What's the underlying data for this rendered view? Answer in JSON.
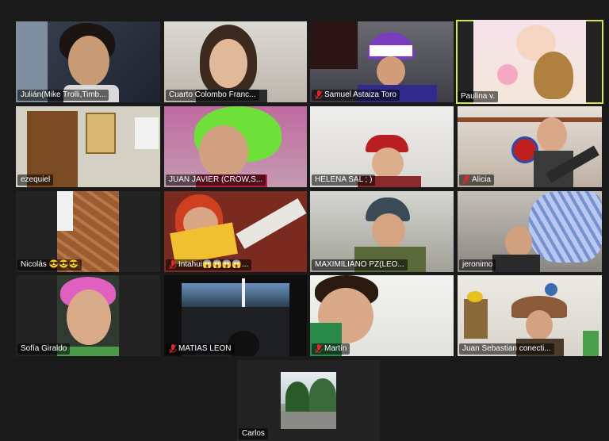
{
  "participants": [
    {
      "id": "p1",
      "name": "Julián(Mike Trolli,Timb...",
      "muted": false
    },
    {
      "id": "p2",
      "name": "Cuarto Colombo Franc...",
      "muted": false
    },
    {
      "id": "p3",
      "name": "Samuel Astaiza Toro",
      "muted": true
    },
    {
      "id": "p4",
      "name": "Paulina v.",
      "muted": false,
      "active_speaker": true
    },
    {
      "id": "p5",
      "name": "ezequiel",
      "muted": false
    },
    {
      "id": "p6",
      "name": "JUAN JAVIER (CROW,S...",
      "muted": false
    },
    {
      "id": "p7",
      "name": "HELENA SAL ; )",
      "muted": false
    },
    {
      "id": "p8",
      "name": "Alicia",
      "muted": true
    },
    {
      "id": "p9",
      "name": "Nicolás 😎😎😎",
      "muted": false
    },
    {
      "id": "p10",
      "name": "Intahui😱😱😱😱...",
      "muted": true
    },
    {
      "id": "p11",
      "name": "MAXIMILIANO PZ(LEO...",
      "muted": false
    },
    {
      "id": "p12",
      "name": "jeronimo",
      "muted": false
    },
    {
      "id": "p13",
      "name": "Sofía Giraldo",
      "muted": false
    },
    {
      "id": "p14",
      "name": "MATIAS LEON",
      "muted": true
    },
    {
      "id": "p15",
      "name": "Martín",
      "muted": true
    },
    {
      "id": "p16",
      "name": "Juan Sebastian conecti...",
      "muted": false
    },
    {
      "id": "p17",
      "name": "Carlos",
      "muted": false
    }
  ],
  "colors": {
    "background": "#1a1a1a",
    "tile": "#232323",
    "active_border": "#d4e84a",
    "mute_red": "#e02828"
  },
  "icons": {
    "muted": "microphone-muted-icon"
  }
}
